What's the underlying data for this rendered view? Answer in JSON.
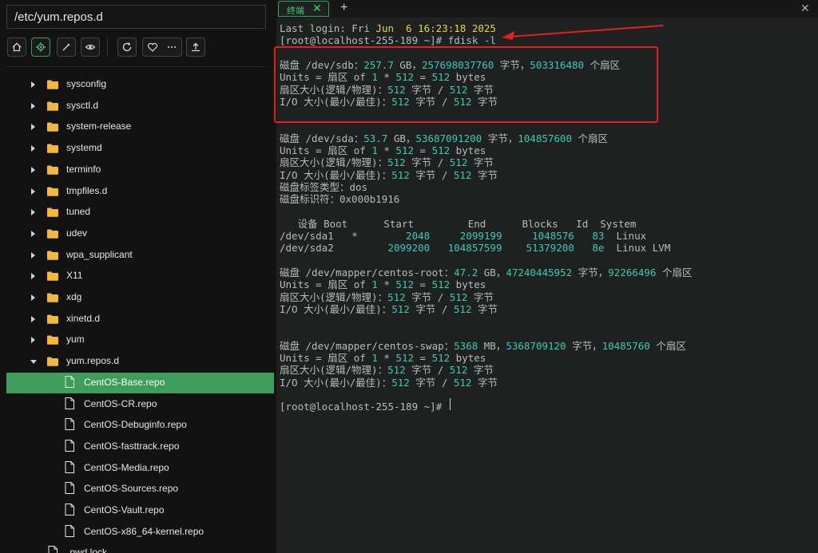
{
  "sidebar": {
    "path": "/etc/yum.repos.d",
    "toolbar_icons": [
      "home-icon",
      "locate-icon",
      "pen-icon",
      "eye-icon",
      "refresh-icon",
      "heart-icon",
      "more-icon",
      "upload-icon"
    ],
    "items": [
      {
        "label": "sysconfig",
        "type": "folder",
        "expanded": false
      },
      {
        "label": "sysctl.d",
        "type": "folder",
        "expanded": false
      },
      {
        "label": "system-release",
        "type": "folder",
        "expanded": false
      },
      {
        "label": "systemd",
        "type": "folder",
        "expanded": false
      },
      {
        "label": "terminfo",
        "type": "folder",
        "expanded": false
      },
      {
        "label": "tmpfiles.d",
        "type": "folder",
        "expanded": false
      },
      {
        "label": "tuned",
        "type": "folder",
        "expanded": false
      },
      {
        "label": "udev",
        "type": "folder",
        "expanded": false
      },
      {
        "label": "wpa_supplicant",
        "type": "folder",
        "expanded": false
      },
      {
        "label": "X11",
        "type": "folder",
        "expanded": false
      },
      {
        "label": "xdg",
        "type": "folder",
        "expanded": false
      },
      {
        "label": "xinetd.d",
        "type": "folder",
        "expanded": false
      },
      {
        "label": "yum",
        "type": "folder",
        "expanded": false
      },
      {
        "label": "yum.repos.d",
        "type": "folder",
        "expanded": true
      },
      {
        "label": "CentOS-Base.repo",
        "type": "file",
        "selected": true
      },
      {
        "label": "CentOS-CR.repo",
        "type": "file"
      },
      {
        "label": "CentOS-Debuginfo.repo",
        "type": "file"
      },
      {
        "label": "CentOS-fasttrack.repo",
        "type": "file"
      },
      {
        "label": "CentOS-Media.repo",
        "type": "file"
      },
      {
        "label": "CentOS-Sources.repo",
        "type": "file"
      },
      {
        "label": "CentOS-Vault.repo",
        "type": "file"
      },
      {
        "label": "CentOS-x86_64-kernel.repo",
        "type": "file"
      },
      {
        "label": ".pwd.lock",
        "type": "file"
      }
    ]
  },
  "terminal": {
    "tab_label": "终端",
    "tab_close": "✕",
    "new_tab": "+",
    "window_close": "✕",
    "lines": [
      [
        [
          "t",
          "Last login: Fri "
        ],
        [
          "y",
          "Jun  6 16:23:18 2025"
        ]
      ],
      [
        [
          "t",
          "[root@localhost-255-189 ~]# fdisk -l"
        ]
      ],
      [
        [
          "t",
          ""
        ]
      ],
      [
        [
          "t",
          "磁盘 /dev/sdb："
        ],
        [
          "h",
          "257.7"
        ],
        [
          "t",
          " GB，"
        ],
        [
          "h",
          "257698037760"
        ],
        [
          "t",
          " 字节，"
        ],
        [
          "h",
          "503316480"
        ],
        [
          "t",
          " 个扇区"
        ]
      ],
      [
        [
          "t",
          "Units = 扇区 of "
        ],
        [
          "h",
          "1"
        ],
        [
          "t",
          " * "
        ],
        [
          "h",
          "512"
        ],
        [
          "t",
          " = "
        ],
        [
          "h",
          "512"
        ],
        [
          "t",
          " bytes"
        ]
      ],
      [
        [
          "t",
          "扇区大小(逻辑/物理)："
        ],
        [
          "h",
          "512"
        ],
        [
          "t",
          " 字节 / "
        ],
        [
          "h",
          "512"
        ],
        [
          "t",
          " 字节"
        ]
      ],
      [
        [
          "t",
          "I/O 大小(最小/最佳)："
        ],
        [
          "h",
          "512"
        ],
        [
          "t",
          " 字节 / "
        ],
        [
          "h",
          "512"
        ],
        [
          "t",
          " 字节"
        ]
      ],
      [
        [
          "t",
          ""
        ]
      ],
      [
        [
          "t",
          ""
        ]
      ],
      [
        [
          "t",
          "磁盘 /dev/sda："
        ],
        [
          "h",
          "53.7"
        ],
        [
          "t",
          " GB，"
        ],
        [
          "h",
          "53687091200"
        ],
        [
          "t",
          " 字节，"
        ],
        [
          "h",
          "104857600"
        ],
        [
          "t",
          " 个扇区"
        ]
      ],
      [
        [
          "t",
          "Units = 扇区 of "
        ],
        [
          "h",
          "1"
        ],
        [
          "t",
          " * "
        ],
        [
          "h",
          "512"
        ],
        [
          "t",
          " = "
        ],
        [
          "h",
          "512"
        ],
        [
          "t",
          " bytes"
        ]
      ],
      [
        [
          "t",
          "扇区大小(逻辑/物理)："
        ],
        [
          "h",
          "512"
        ],
        [
          "t",
          " 字节 / "
        ],
        [
          "h",
          "512"
        ],
        [
          "t",
          " 字节"
        ]
      ],
      [
        [
          "t",
          "I/O 大小(最小/最佳)："
        ],
        [
          "h",
          "512"
        ],
        [
          "t",
          " 字节 / "
        ],
        [
          "h",
          "512"
        ],
        [
          "t",
          " 字节"
        ]
      ],
      [
        [
          "t",
          "磁盘标签类型：dos"
        ]
      ],
      [
        [
          "t",
          "磁盘标识符：0x000b1916"
        ]
      ],
      [
        [
          "t",
          ""
        ]
      ],
      [
        [
          "t",
          "   设备 Boot      Start         End      Blocks   Id  System"
        ]
      ],
      [
        [
          "t",
          "/dev/sda1   *        "
        ],
        [
          "h",
          "2048"
        ],
        [
          "t",
          "     "
        ],
        [
          "h",
          "2099199"
        ],
        [
          "t",
          "     "
        ],
        [
          "h",
          "1048576"
        ],
        [
          "t",
          "   "
        ],
        [
          "h",
          "83"
        ],
        [
          "t",
          "  Linux"
        ]
      ],
      [
        [
          "t",
          "/dev/sda2         "
        ],
        [
          "h",
          "2099200"
        ],
        [
          "t",
          "   "
        ],
        [
          "h",
          "104857599"
        ],
        [
          "t",
          "    "
        ],
        [
          "h",
          "51379200"
        ],
        [
          "t",
          "   "
        ],
        [
          "h",
          "8e"
        ],
        [
          "t",
          "  Linux LVM"
        ]
      ],
      [
        [
          "t",
          ""
        ]
      ],
      [
        [
          "t",
          "磁盘 /dev/mapper/centos-root："
        ],
        [
          "h",
          "47.2"
        ],
        [
          "t",
          " GB，"
        ],
        [
          "h",
          "47240445952"
        ],
        [
          "t",
          " 字节，"
        ],
        [
          "h",
          "92266496"
        ],
        [
          "t",
          " 个扇区"
        ]
      ],
      [
        [
          "t",
          "Units = 扇区 of "
        ],
        [
          "h",
          "1"
        ],
        [
          "t",
          " * "
        ],
        [
          "h",
          "512"
        ],
        [
          "t",
          " = "
        ],
        [
          "h",
          "512"
        ],
        [
          "t",
          " bytes"
        ]
      ],
      [
        [
          "t",
          "扇区大小(逻辑/物理)："
        ],
        [
          "h",
          "512"
        ],
        [
          "t",
          " 字节 / "
        ],
        [
          "h",
          "512"
        ],
        [
          "t",
          " 字节"
        ]
      ],
      [
        [
          "t",
          "I/O 大小(最小/最佳)："
        ],
        [
          "h",
          "512"
        ],
        [
          "t",
          " 字节 / "
        ],
        [
          "h",
          "512"
        ],
        [
          "t",
          " 字节"
        ]
      ],
      [
        [
          "t",
          ""
        ]
      ],
      [
        [
          "t",
          ""
        ]
      ],
      [
        [
          "t",
          "磁盘 /dev/mapper/centos-swap："
        ],
        [
          "h",
          "5368"
        ],
        [
          "t",
          " MB，"
        ],
        [
          "h",
          "5368709120"
        ],
        [
          "t",
          " 字节，"
        ],
        [
          "h",
          "10485760"
        ],
        [
          "t",
          " 个扇区"
        ]
      ],
      [
        [
          "t",
          "Units = 扇区 of "
        ],
        [
          "h",
          "1"
        ],
        [
          "t",
          " * "
        ],
        [
          "h",
          "512"
        ],
        [
          "t",
          " = "
        ],
        [
          "h",
          "512"
        ],
        [
          "t",
          " bytes"
        ]
      ],
      [
        [
          "t",
          "扇区大小(逻辑/物理)："
        ],
        [
          "h",
          "512"
        ],
        [
          "t",
          " 字节 / "
        ],
        [
          "h",
          "512"
        ],
        [
          "t",
          " 字节"
        ]
      ],
      [
        [
          "t",
          "I/O 大小(最小/最佳)："
        ],
        [
          "h",
          "512"
        ],
        [
          "t",
          " 字节 / "
        ],
        [
          "h",
          "512"
        ],
        [
          "t",
          " 字节"
        ]
      ],
      [
        [
          "t",
          ""
        ]
      ],
      [
        [
          "t",
          "[root@localhost-255-189 ~]# "
        ]
      ]
    ]
  },
  "colors": {
    "accent_green": "#3e9d5a",
    "highlight_cyan": "#3fc8b8",
    "date_yellow": "#e6d34a",
    "annotation_red": "#e02020"
  }
}
